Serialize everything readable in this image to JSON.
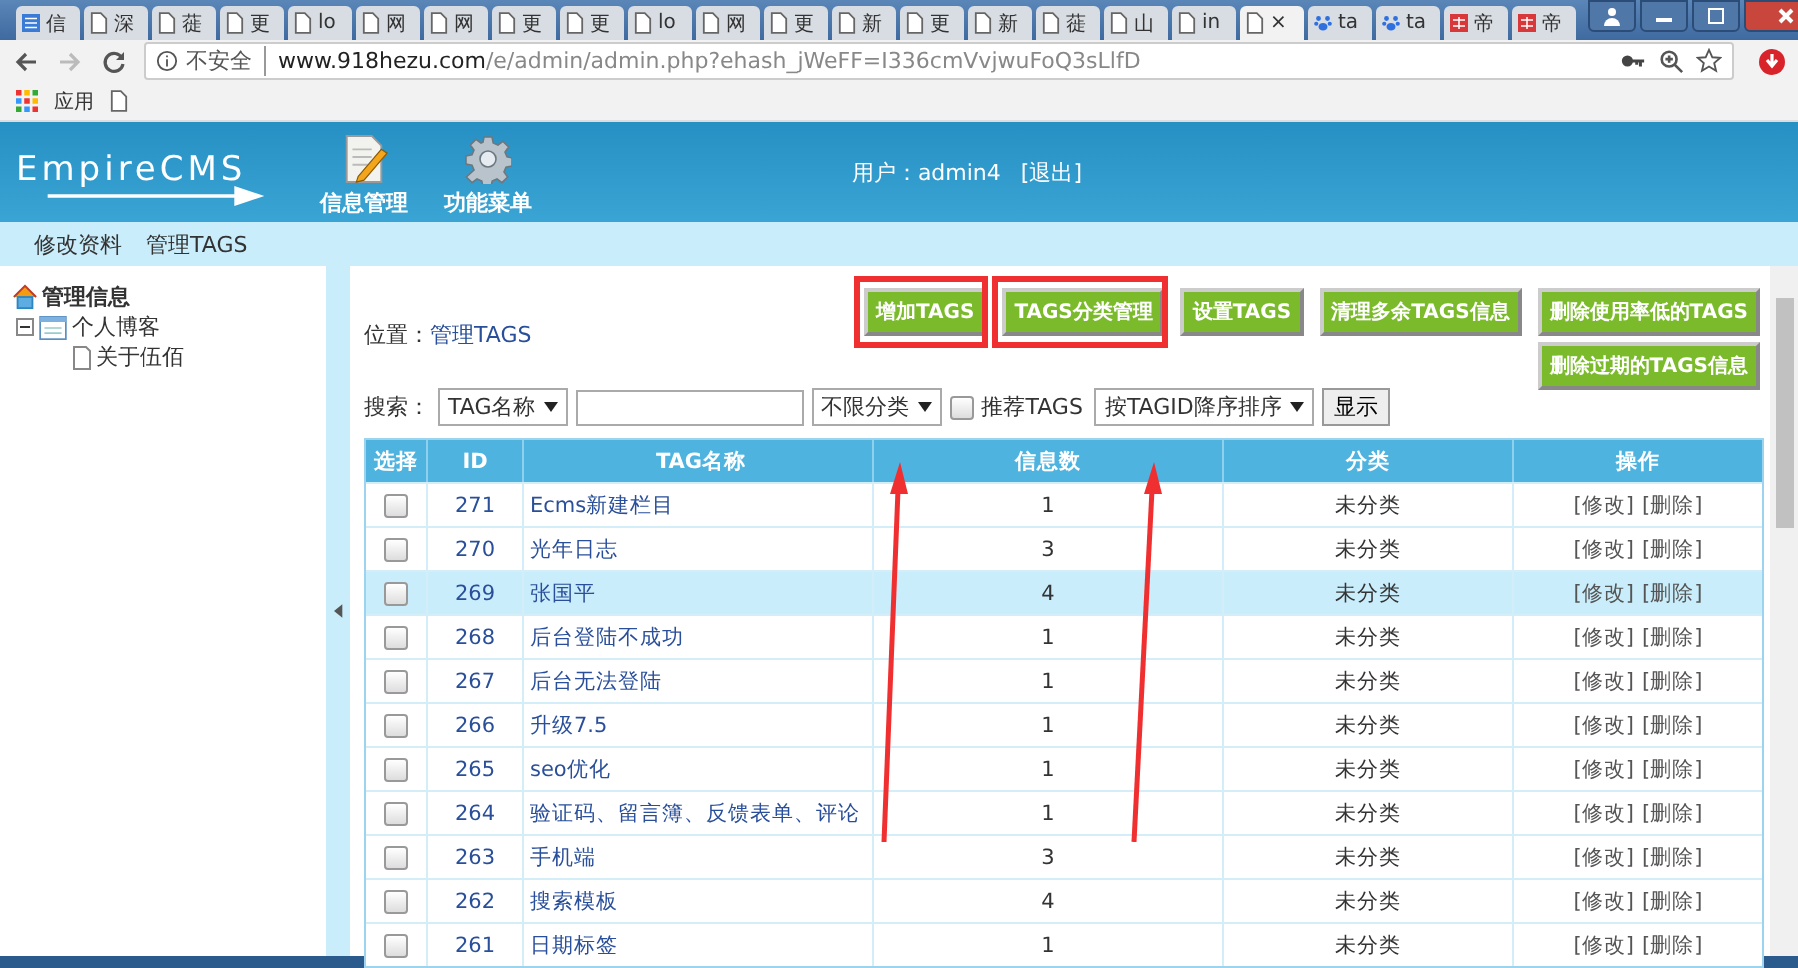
{
  "browser": {
    "tabs": [
      {
        "label": "信",
        "kind": "logo",
        "selected": false
      },
      {
        "label": "深",
        "kind": "page",
        "selected": false
      },
      {
        "label": "蓰",
        "kind": "page",
        "selected": false
      },
      {
        "label": "更",
        "kind": "page",
        "selected": false
      },
      {
        "label": "lo",
        "kind": "page",
        "selected": false
      },
      {
        "label": "网",
        "kind": "page",
        "selected": false
      },
      {
        "label": "网",
        "kind": "page",
        "selected": false
      },
      {
        "label": "更",
        "kind": "page",
        "selected": false
      },
      {
        "label": "更",
        "kind": "page",
        "selected": false
      },
      {
        "label": "lo",
        "kind": "page",
        "selected": false
      },
      {
        "label": "网",
        "kind": "page",
        "selected": false
      },
      {
        "label": "更",
        "kind": "page",
        "selected": false
      },
      {
        "label": "新",
        "kind": "page",
        "selected": false
      },
      {
        "label": "更",
        "kind": "page",
        "selected": false
      },
      {
        "label": "新",
        "kind": "page",
        "selected": false
      },
      {
        "label": "蓰",
        "kind": "page",
        "selected": false
      },
      {
        "label": "山",
        "kind": "page",
        "selected": false
      },
      {
        "label": "in",
        "kind": "page",
        "selected": false
      },
      {
        "label": "×",
        "kind": "page",
        "selected": true
      },
      {
        "label": "ta",
        "kind": "paw",
        "selected": false
      },
      {
        "label": "ta",
        "kind": "paw",
        "selected": false
      },
      {
        "label": "帝",
        "kind": "grid",
        "selected": false
      },
      {
        "label": "帝",
        "kind": "grid",
        "selected": false
      }
    ],
    "security": "不安全",
    "url_host": "www.918hezu.com",
    "url_path": "/e/admin/admin.php?ehash_jWeFF=I336cmVvjwuFoQ3sLlfD",
    "bookmarks": [
      "应用"
    ]
  },
  "header": {
    "logo": "EmpireCMS",
    "nav": [
      {
        "label": "信息管理",
        "kind": "doc"
      },
      {
        "label": "功能菜单",
        "kind": "gear"
      }
    ],
    "user": "用户：admin4",
    "logout": "[退出]"
  },
  "subnav": [
    "修改资料",
    "管理TAGS"
  ],
  "sidebar": {
    "title": "管理信息",
    "items": [
      {
        "label": "个人博客",
        "expanded": true,
        "children": [
          {
            "label": "关于伍佰"
          }
        ]
      }
    ]
  },
  "main": {
    "location_label": "位置：",
    "location_link": "管理TAGS",
    "buttons": [
      "增加TAGS",
      "TAGS分类管理",
      "设置TAGS",
      "清理多余TAGS信息",
      "删除使用率低的TAGS",
      "删除过期的TAGS信息"
    ],
    "search": {
      "label": "搜索：",
      "field_select": "TAG名称",
      "class_select": "不限分类",
      "recommend_checked": false,
      "recommend_label": "推荐TAGS",
      "order_select": "按TAGID降序排序",
      "submit": "显示"
    },
    "table": {
      "columns": [
        "选择",
        "ID",
        "TAG名称",
        "信息数",
        "分类",
        "操作"
      ],
      "rows": [
        {
          "checked": false,
          "highlighted": false,
          "id": "271",
          "name": "Ecms新建栏目",
          "count": "1",
          "category": "未分类",
          "edit": "[修改]",
          "delete": "[删除]"
        },
        {
          "checked": false,
          "highlighted": false,
          "id": "270",
          "name": "光年日志",
          "count": "3",
          "category": "未分类",
          "edit": "[修改]",
          "delete": "[删除]"
        },
        {
          "checked": false,
          "highlighted": true,
          "id": "269",
          "name": "张国平",
          "count": "4",
          "category": "未分类",
          "edit": "[修改]",
          "delete": "[删除]"
        },
        {
          "checked": false,
          "highlighted": false,
          "id": "268",
          "name": "后台登陆不成功",
          "count": "1",
          "category": "未分类",
          "edit": "[修改]",
          "delete": "[删除]"
        },
        {
          "checked": false,
          "highlighted": false,
          "id": "267",
          "name": "后台无法登陆",
          "count": "1",
          "category": "未分类",
          "edit": "[修改]",
          "delete": "[删除]"
        },
        {
          "checked": false,
          "highlighted": false,
          "id": "266",
          "name": "升级7.5",
          "count": "1",
          "category": "未分类",
          "edit": "[修改]",
          "delete": "[删除]"
        },
        {
          "checked": false,
          "highlighted": false,
          "id": "265",
          "name": "seo优化",
          "count": "1",
          "category": "未分类",
          "edit": "[修改]",
          "delete": "[删除]"
        },
        {
          "checked": false,
          "highlighted": false,
          "id": "264",
          "name": "验证码、留言簿、反馈表单、评论",
          "count": "1",
          "category": "未分类",
          "edit": "[修改]",
          "delete": "[删除]"
        },
        {
          "checked": false,
          "highlighted": false,
          "id": "263",
          "name": "手机端",
          "count": "3",
          "category": "未分类",
          "edit": "[修改]",
          "delete": "[删除]"
        },
        {
          "checked": false,
          "highlighted": false,
          "id": "262",
          "name": "搜索模板",
          "count": "4",
          "category": "未分类",
          "edit": "[修改]",
          "delete": "[删除]"
        },
        {
          "checked": false,
          "highlighted": false,
          "id": "261",
          "name": "日期标签",
          "count": "1",
          "category": "未分类",
          "edit": "[修改]",
          "delete": "[删除]"
        }
      ]
    }
  }
}
